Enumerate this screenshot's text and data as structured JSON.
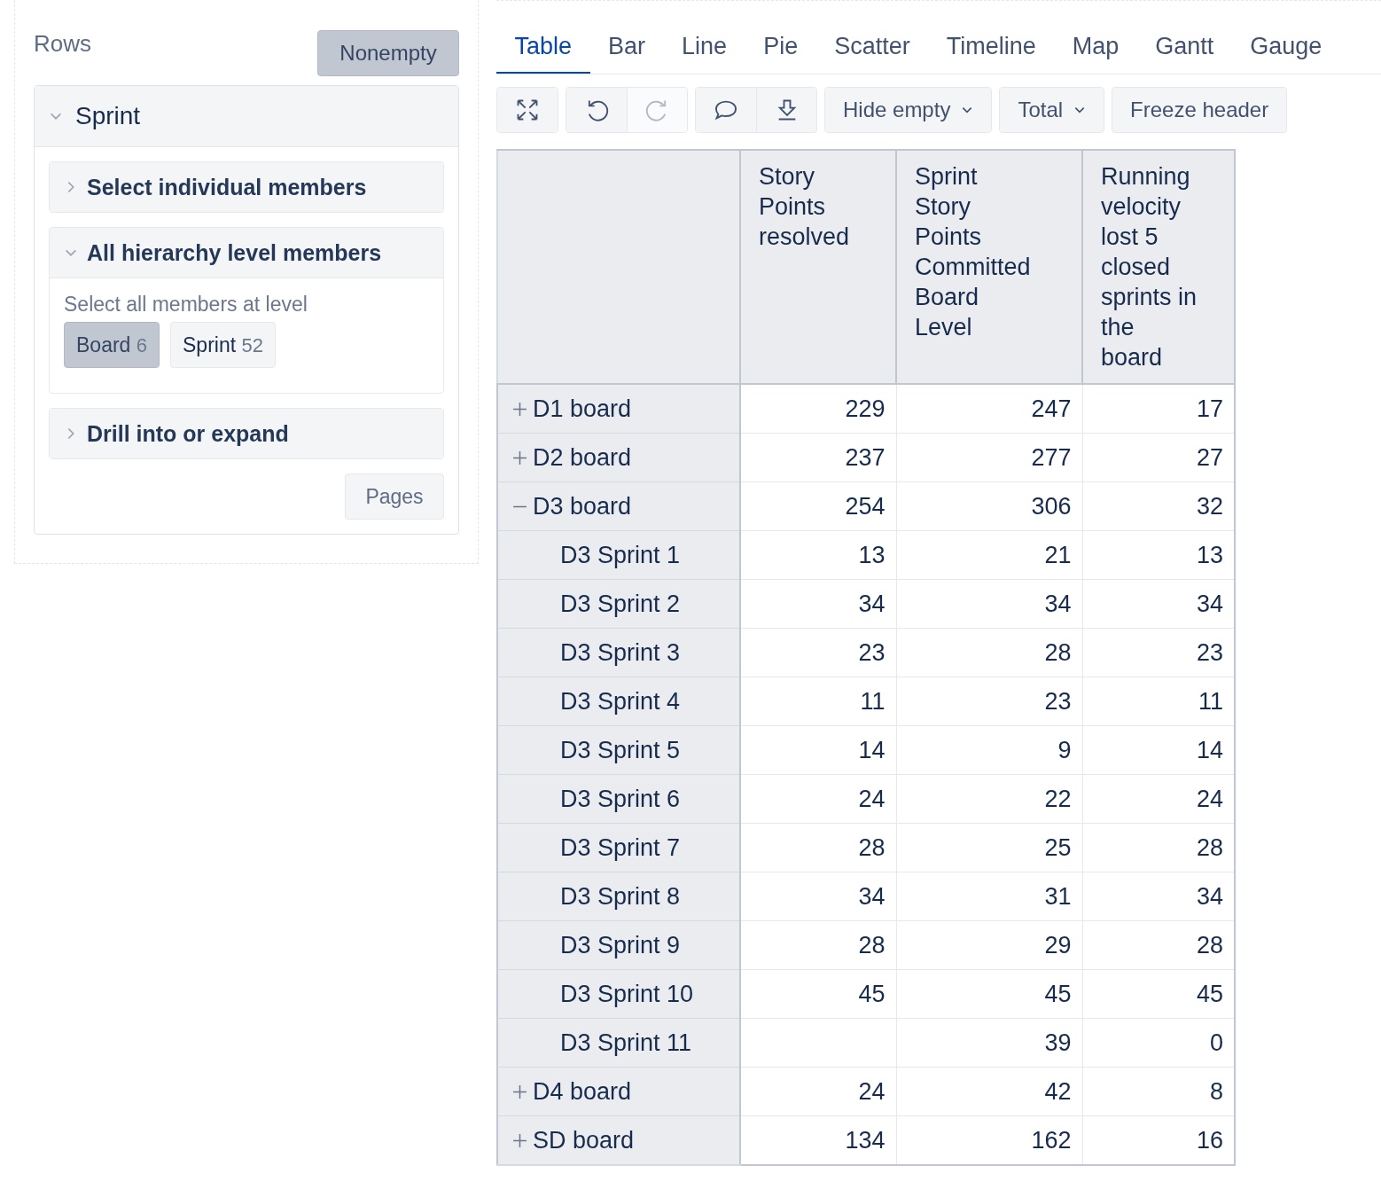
{
  "rows_panel": {
    "title": "Rows",
    "nonempty": {
      "label": "Nonempty",
      "selected": true
    },
    "dimension": {
      "name": "Sprint",
      "expanded": true,
      "sections": [
        {
          "title": "Select individual members",
          "expanded": false
        },
        {
          "title": "All hierarchy level members",
          "expanded": true,
          "hint": "Select all members at level",
          "levels": [
            {
              "name": "Board",
              "count": "6",
              "selected": true
            },
            {
              "name": "Sprint",
              "count": "52",
              "selected": false
            }
          ]
        },
        {
          "title": "Drill into or expand",
          "expanded": false
        }
      ],
      "pages_button": "Pages"
    }
  },
  "tabs": [
    {
      "label": "Table",
      "selected": true
    },
    {
      "label": "Bar",
      "selected": false
    },
    {
      "label": "Line",
      "selected": false
    },
    {
      "label": "Pie",
      "selected": false
    },
    {
      "label": "Scatter",
      "selected": false
    },
    {
      "label": "Timeline",
      "selected": false
    },
    {
      "label": "Map",
      "selected": false
    },
    {
      "label": "Gantt",
      "selected": false
    },
    {
      "label": "Gauge",
      "selected": false
    }
  ],
  "toolbar": [
    [
      {
        "kind": "fullscreen",
        "disabled": false
      }
    ],
    [
      {
        "kind": "undo",
        "disabled": false
      },
      {
        "kind": "redo",
        "disabled": true
      }
    ],
    [
      {
        "kind": "comment",
        "disabled": false
      },
      {
        "kind": "download",
        "disabled": false
      }
    ],
    [
      {
        "kind": "dropdown",
        "label": "Hide empty",
        "disabled": false
      }
    ],
    [
      {
        "kind": "dropdown",
        "label": "Total",
        "disabled": false
      }
    ],
    [
      {
        "kind": "text",
        "label": "Freeze header",
        "disabled": false
      }
    ]
  ],
  "table": {
    "columns": [
      "Story Points resolved",
      "Sprint Story Points Committed Board Level",
      "Running velocity lost 5 closed sprints in the board"
    ],
    "rows": [
      {
        "label": "D1 board",
        "expanded": false,
        "resolved": "229",
        "committed": "247",
        "velocity_lost": "17"
      },
      {
        "label": "D2 board",
        "expanded": false,
        "resolved": "237",
        "committed": "277",
        "velocity_lost": "27"
      },
      {
        "label": "D3 board",
        "expanded": true,
        "resolved": "254",
        "committed": "306",
        "velocity_lost": "32",
        "children": [
          {
            "label": "D3 Sprint 1",
            "resolved": "13",
            "committed": "21",
            "velocity_lost": "13"
          },
          {
            "label": "D3 Sprint 2",
            "resolved": "34",
            "committed": "34",
            "velocity_lost": "34"
          },
          {
            "label": "D3 Sprint 3",
            "resolved": "23",
            "committed": "28",
            "velocity_lost": "23"
          },
          {
            "label": "D3 Sprint 4",
            "resolved": "11",
            "committed": "23",
            "velocity_lost": "11"
          },
          {
            "label": "D3 Sprint 5",
            "resolved": "14",
            "committed": "9",
            "velocity_lost": "14"
          },
          {
            "label": "D3 Sprint 6",
            "resolved": "24",
            "committed": "22",
            "velocity_lost": "24"
          },
          {
            "label": "D3 Sprint 7",
            "resolved": "28",
            "committed": "25",
            "velocity_lost": "28"
          },
          {
            "label": "D3 Sprint 8",
            "resolved": "34",
            "committed": "31",
            "velocity_lost": "34"
          },
          {
            "label": "D3 Sprint 9",
            "resolved": "28",
            "committed": "29",
            "velocity_lost": "28"
          },
          {
            "label": "D3 Sprint 10",
            "resolved": "45",
            "committed": "45",
            "velocity_lost": "45"
          },
          {
            "label": "D3 Sprint 11",
            "committed": "39",
            "velocity_lost": "0"
          }
        ]
      },
      {
        "label": "D4 board",
        "expanded": false,
        "resolved": "24",
        "committed": "42",
        "velocity_lost": "8"
      },
      {
        "label": "SD board",
        "expanded": false,
        "resolved": "134",
        "committed": "162",
        "velocity_lost": "16"
      }
    ]
  }
}
